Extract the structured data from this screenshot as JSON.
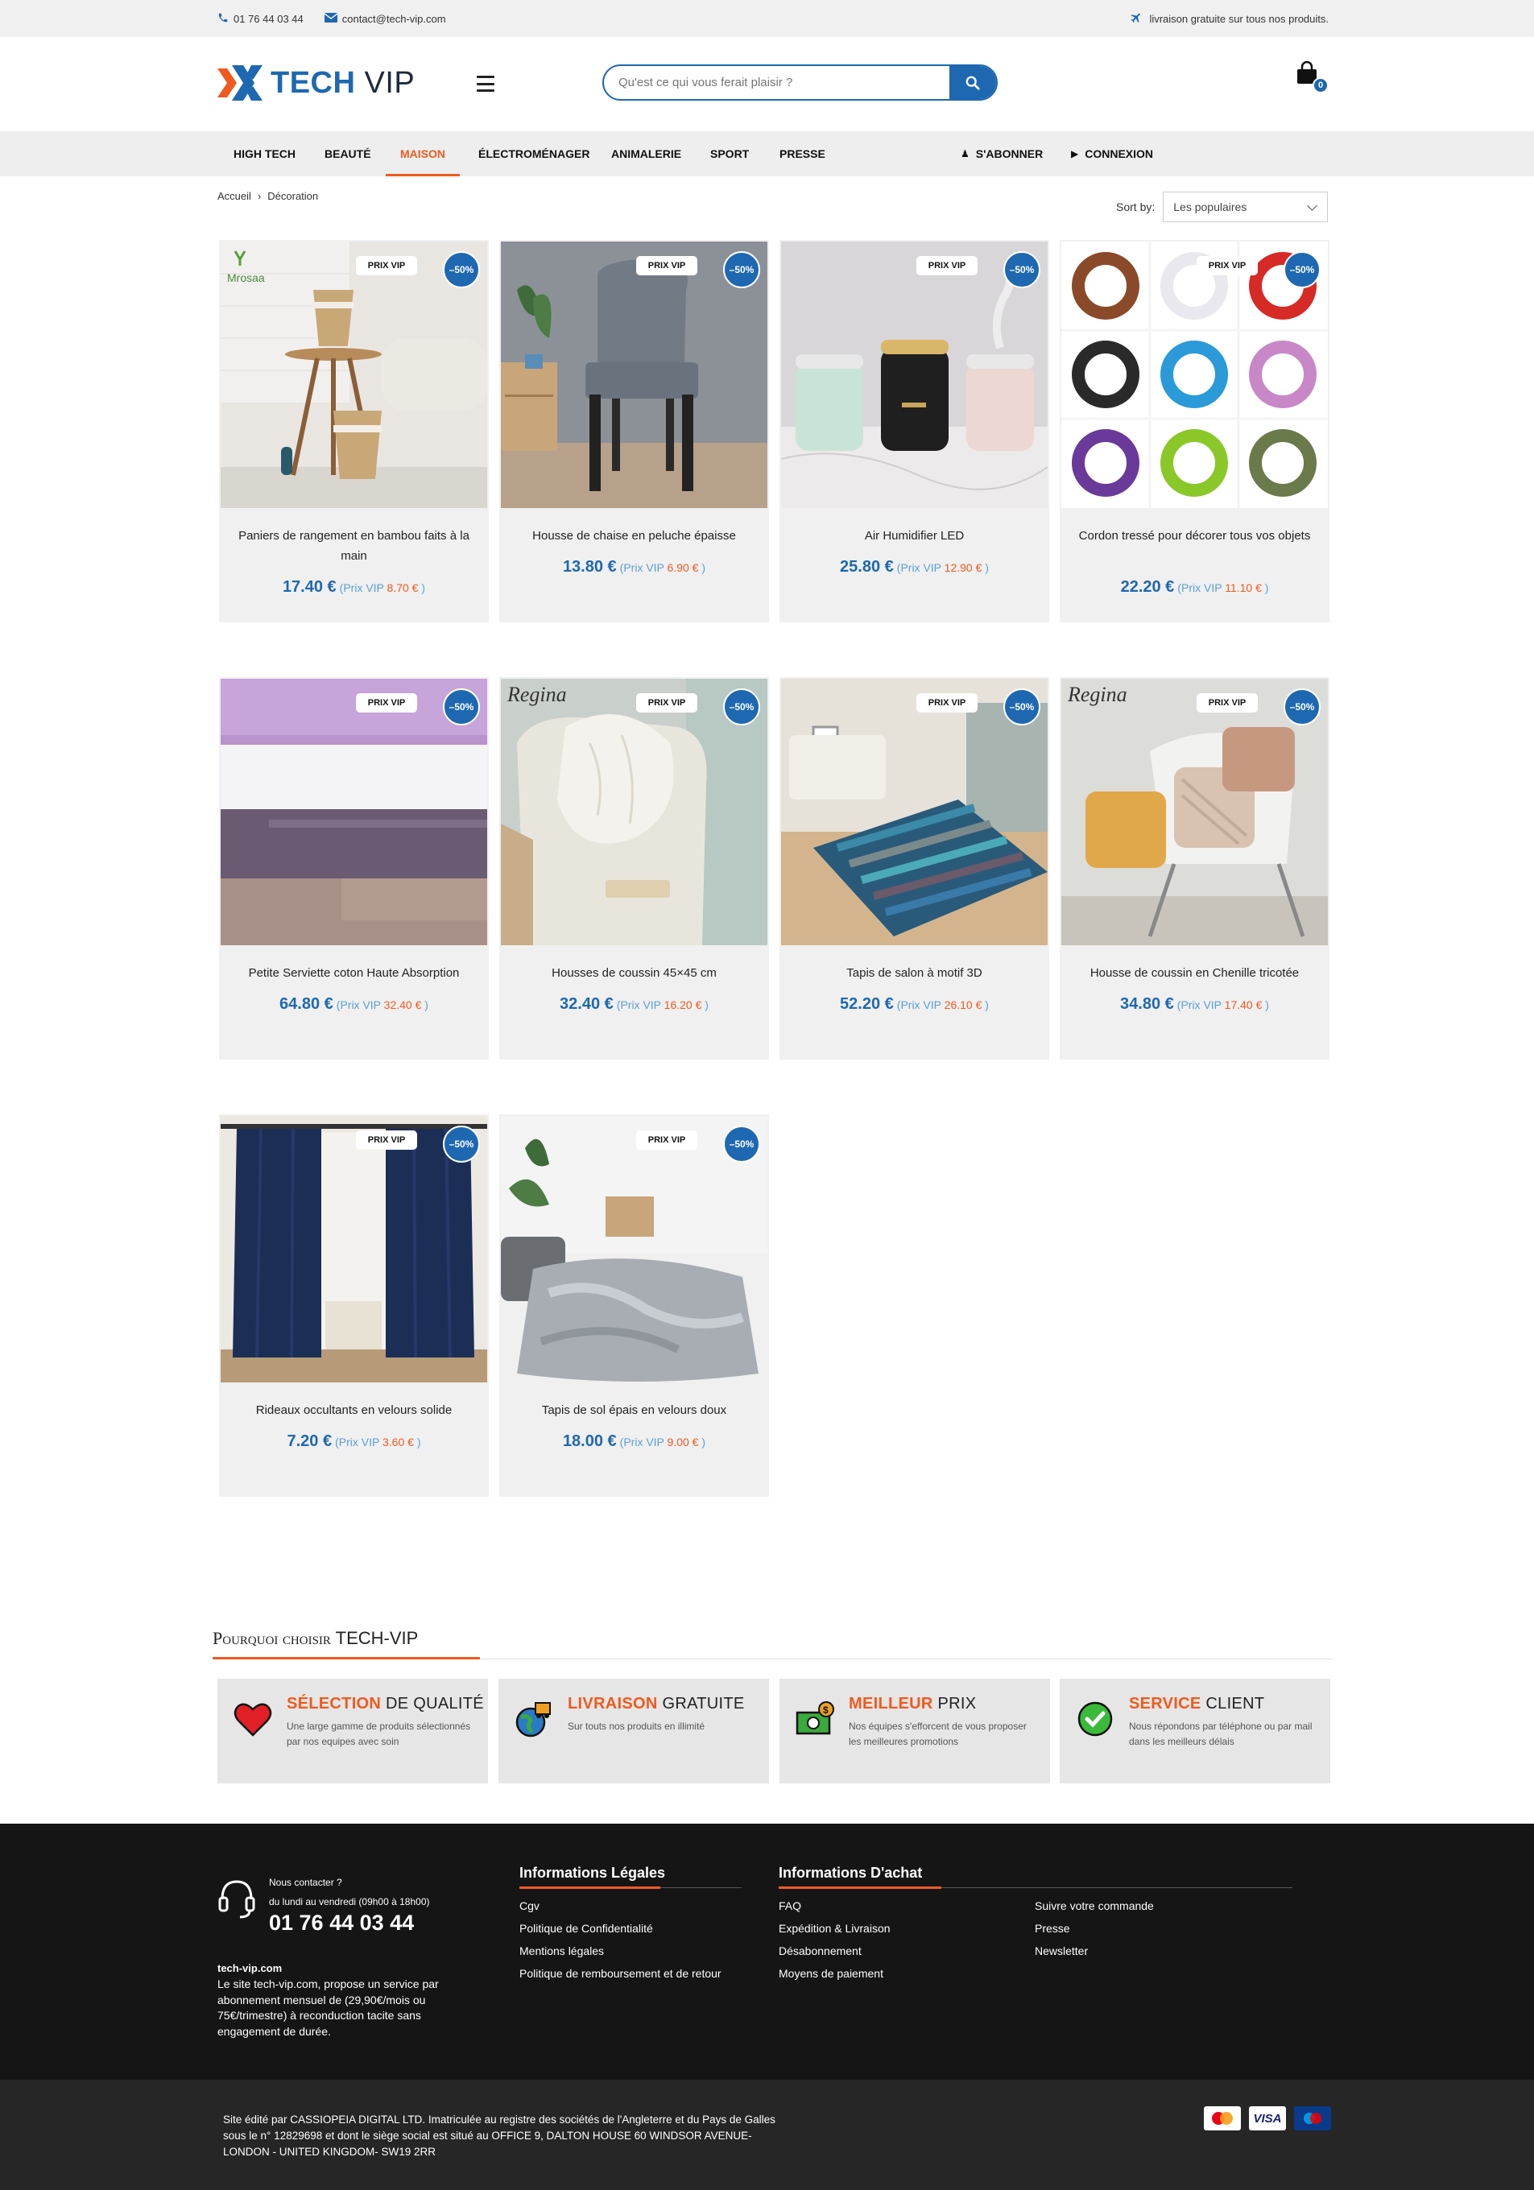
{
  "topbar": {
    "phone": "01 76 44 03 44",
    "email": "contact@tech-vip.com",
    "shipping": "livraison gratuite sur tous nos produits."
  },
  "header": {
    "logo_bold": "TECH",
    "logo_light": "VIP",
    "search_placeholder": "Qu'est ce qui vous ferait plaisir ?",
    "cart_count": "0"
  },
  "nav": {
    "items": [
      "HIGH TECH",
      "BEAUTÉ",
      "MAISON",
      "ÉLECTROMÉNAGER",
      "ANIMALERIE",
      "SPORT",
      "PRESSE"
    ],
    "active": "MAISON",
    "subscribe": "S'ABONNER",
    "login": "CONNEXION"
  },
  "breadcrumb": {
    "home": "Accueil",
    "sep": "›",
    "current": "Décoration"
  },
  "sort": {
    "label": "Sort by:",
    "value": "Les populaires"
  },
  "badges": {
    "vip": "PRIX VIP",
    "discount": "–50%"
  },
  "products": [
    {
      "title": "Paniers de rangement en bambou faits à la main",
      "price": "17.40 €",
      "vip_label": "(Prix VIP",
      "vip_price": "8.70 €",
      "close": ")"
    },
    {
      "title": "Housse de chaise en peluche épaisse",
      "price": "13.80 €",
      "vip_label": "(Prix VIP",
      "vip_price": "6.90 €",
      "close": ")"
    },
    {
      "title": "Air Humidifier LED",
      "price": "25.80 €",
      "vip_label": "(Prix VIP",
      "vip_price": "12.90 €",
      "close": ")"
    },
    {
      "title": "Cordon tressé pour décorer tous vos objets",
      "price": "22.20 €",
      "vip_label": "(Prix VIP",
      "vip_price": "11.10 €",
      "close": ")"
    },
    {
      "title": "Petite Serviette coton Haute Absorption",
      "price": "64.80 €",
      "vip_label": "(Prix VIP",
      "vip_price": "32.40 €",
      "close": ")"
    },
    {
      "title": "Housses de coussin 45×45 cm",
      "price": "32.40 €",
      "vip_label": "(Prix VIP",
      "vip_price": "16.20 €",
      "close": ")"
    },
    {
      "title": "Tapis de salon à motif 3D",
      "price": "52.20 €",
      "vip_label": "(Prix VIP",
      "vip_price": "26.10 €",
      "close": ")"
    },
    {
      "title": "Housse de coussin en Chenille tricotée",
      "price": "34.80 €",
      "vip_label": "(Prix VIP",
      "vip_price": "17.40 €",
      "close": ")"
    },
    {
      "title": "Rideaux occultants en velours solide",
      "price": "7.20 €",
      "vip_label": "(Prix VIP",
      "vip_price": "3.60 €",
      "close": ")"
    },
    {
      "title": "Tapis de sol épais en velours doux",
      "price": "18.00 €",
      "vip_label": "(Prix VIP",
      "vip_price": "9.00 €",
      "close": ")"
    }
  ],
  "image_brands": {
    "p1": "Mrosaa",
    "p2": "Regina",
    "p3": "Regina"
  },
  "why": {
    "title_a": "Pourquoi choisir",
    "title_b": "TECH-VIP",
    "features": [
      {
        "accent": "SÉLECTION",
        "rest": "DE QUALITÉ",
        "text": "Une large gamme de produits sélectionnés par nos equipes avec soin",
        "icon": "heart-icon"
      },
      {
        "accent": "LIVRAISON",
        "rest": "GRATUITE",
        "text": "Sur touts nos produits en illimité",
        "icon": "globe-delivery-icon"
      },
      {
        "accent": "MEILLEUR",
        "rest": "PRIX",
        "text": "Nos équipes s'efforcent de vous proposer les meilleures promotions",
        "icon": "money-icon"
      },
      {
        "accent": "SERVICE",
        "rest": "CLIENT",
        "text": "Nous répondons par téléphone ou par mail dans les meilleurs délais",
        "icon": "check-icon"
      }
    ]
  },
  "footer": {
    "contact_label": "Nous contacter ?",
    "hours": "du lundi au vendredi (09h00 à 18h00)",
    "phone": "01 76 44 03 44",
    "site": "tech-vip.com",
    "desc": "Le site tech-vip.com, propose un service par abonnement mensuel de (29,90€/mois ou 75€/trimestre) à reconduction tacite sans engagement de durée.",
    "legal_title": "Informations Légales",
    "legal_links": [
      "Cgv",
      "Politique de Confidentialité",
      "Mentions légales",
      "Politique de remboursement et de retour"
    ],
    "purchase_title": "Informations D'achat",
    "purchase_links_a": [
      "FAQ",
      "Expédition & Livraison",
      "Désabonnement",
      "Moyens de paiement"
    ],
    "purchase_links_b": [
      "Suivre votre commande",
      "Presse",
      "Newsletter"
    ]
  },
  "bottom": {
    "text": "Site édité par CASSIOPEIA DIGITAL LTD. Imatriculée au registre des sociétés de l'Angleterre et du Pays de Galles sous le n° 12829698 et dont le siège social est situé au OFFICE 9, DALTON HOUSE 60 WINDSOR AVENUE- LONDON - UNITED KINGDOM- SW19 2RR",
    "payments": [
      "mastercard-icon",
      "visa-icon",
      "maestro-icon"
    ],
    "visa_label": "VISA"
  },
  "colors": {
    "brand_blue": "#1e68b1",
    "accent_orange": "#f05a1f"
  }
}
